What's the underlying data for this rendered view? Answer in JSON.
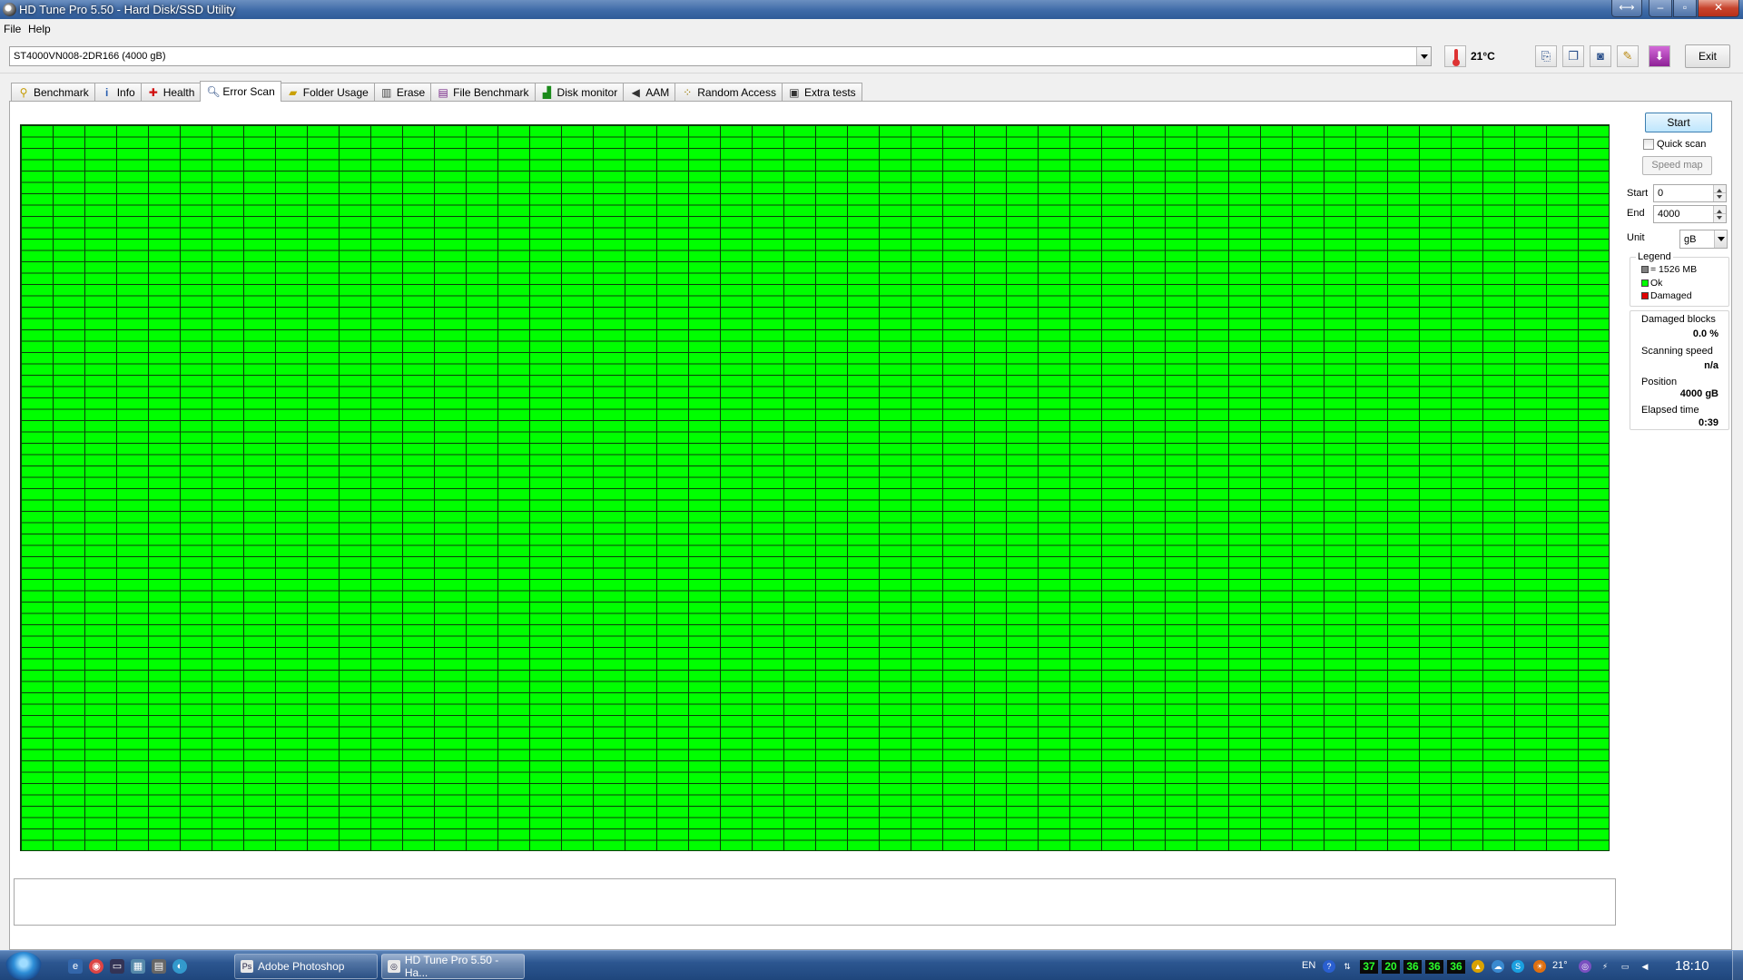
{
  "window": {
    "title": "HD Tune Pro 5.50 - Hard Disk/SSD Utility"
  },
  "menu": {
    "file": "File",
    "help": "Help"
  },
  "toolbar": {
    "drive": "ST4000VN008-2DR166 (4000 gB)",
    "temperature": "21°C",
    "exit_label": "Exit",
    "icons": [
      "copy-info-icon",
      "copy-all-icon",
      "screenshot-icon",
      "options-icon",
      "save-icon"
    ]
  },
  "tabs": [
    {
      "label": "Benchmark",
      "icon": "benchmark-icon"
    },
    {
      "label": "Info",
      "icon": "info-icon"
    },
    {
      "label": "Health",
      "icon": "health-icon"
    },
    {
      "label": "Error Scan",
      "icon": "magnifier-icon",
      "active": true
    },
    {
      "label": "Folder Usage",
      "icon": "folder-icon"
    },
    {
      "label": "Erase",
      "icon": "trash-icon"
    },
    {
      "label": "File Benchmark",
      "icon": "file-benchmark-icon"
    },
    {
      "label": "Disk monitor",
      "icon": "disk-monitor-icon"
    },
    {
      "label": "AAM",
      "icon": "speaker-icon"
    },
    {
      "label": "Random Access",
      "icon": "random-access-icon"
    },
    {
      "label": "Extra tests",
      "icon": "extra-tests-icon"
    }
  ],
  "scan": {
    "start_label": "Start",
    "quick_scan_label": "Quick scan",
    "quick_scan_checked": false,
    "speed_map_label": "Speed map",
    "start_field_label": "Start",
    "start_value": "0",
    "end_field_label": "End",
    "end_value": "4000",
    "unit_label": "Unit",
    "unit_value": "gB",
    "block_colors": {
      "ok": "#00ff00",
      "damaged": "#e00000",
      "unscanned": "#808080"
    }
  },
  "legend": {
    "title": "Legend",
    "block_size": "= 1526 MB",
    "ok": "Ok",
    "damaged": "Damaged"
  },
  "stats": {
    "damaged_blocks_label": "Damaged blocks",
    "damaged_blocks_value": "0.0 %",
    "scanning_speed_label": "Scanning speed",
    "scanning_speed_value": "n/a",
    "position_label": "Position",
    "position_value": "4000 gB",
    "elapsed_label": "Elapsed time",
    "elapsed_value": "0:39"
  },
  "taskbar": {
    "buttons": [
      {
        "label": "Adobe Photoshop"
      },
      {
        "label": "HD Tune Pro 5.50 - Ha..."
      }
    ],
    "tray": {
      "language": "EN",
      "temps": [
        "37",
        "20",
        "36",
        "36",
        "36"
      ],
      "weather_temp": "21°",
      "clock": "18:10"
    }
  }
}
